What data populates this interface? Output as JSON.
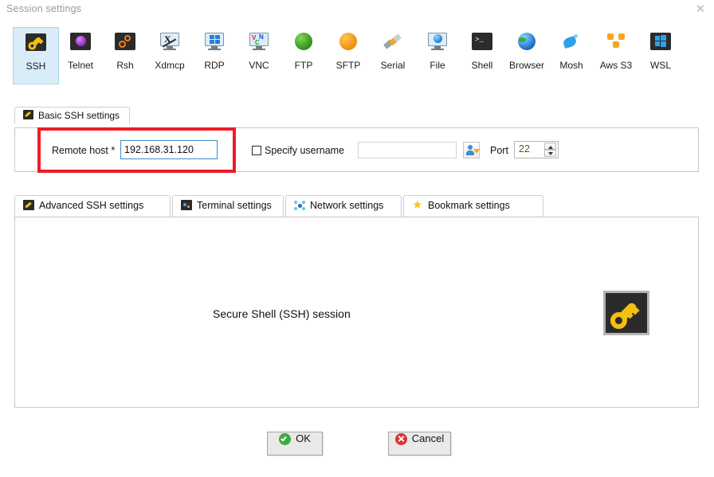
{
  "window": {
    "title": "Session settings",
    "close_label": "✕"
  },
  "session_types": [
    {
      "label": "SSH",
      "icon": "ssh-key-icon",
      "selected": true
    },
    {
      "label": "Telnet",
      "icon": "telnet-orb-icon",
      "selected": false
    },
    {
      "label": "Rsh",
      "icon": "rsh-gears-icon",
      "selected": false
    },
    {
      "label": "Xdmcp",
      "icon": "xdmcp-monitor-icon",
      "selected": false
    },
    {
      "label": "RDP",
      "icon": "rdp-monitor-icon",
      "selected": false
    },
    {
      "label": "VNC",
      "icon": "vnc-monitor-icon",
      "selected": false
    },
    {
      "label": "FTP",
      "icon": "ftp-green-globe-icon",
      "selected": false
    },
    {
      "label": "SFTP",
      "icon": "sftp-orange-globe-icon",
      "selected": false
    },
    {
      "label": "Serial",
      "icon": "serial-plug-icon",
      "selected": false
    },
    {
      "label": "File",
      "icon": "file-monitor-globe-icon",
      "selected": false
    },
    {
      "label": "Shell",
      "icon": "shell-terminal-icon",
      "selected": false
    },
    {
      "label": "Browser",
      "icon": "browser-globe-icon",
      "selected": false
    },
    {
      "label": "Mosh",
      "icon": "mosh-satellite-icon",
      "selected": false
    },
    {
      "label": "Aws S3",
      "icon": "aws-s3-icon",
      "selected": false
    },
    {
      "label": "WSL",
      "icon": "wsl-windows-icon",
      "selected": false
    }
  ],
  "basic_settings": {
    "tab_label": "Basic SSH settings",
    "remote_host_label": "Remote host *",
    "remote_host_value": "192.168.31.120",
    "specify_username_label": "Specify username",
    "specify_username_checked": false,
    "username_value": "",
    "port_label": "Port",
    "port_value": "22"
  },
  "lower_tabs": [
    {
      "label": "Advanced SSH settings",
      "icon": "ssh-key-icon"
    },
    {
      "label": "Terminal settings",
      "icon": "terminal-icon"
    },
    {
      "label": "Network settings",
      "icon": "network-atom-icon"
    },
    {
      "label": "Bookmark settings",
      "icon": "star-icon"
    }
  ],
  "content": {
    "description": "Secure Shell (SSH) session",
    "icon": "ssh-key-large-icon"
  },
  "buttons": {
    "ok_label": "OK",
    "cancel_label": "Cancel"
  },
  "colors": {
    "accent_blue": "#3f8ccb",
    "selection_bg": "#d9edf9",
    "annotation_red": "#ee1c25",
    "key_yellow": "#f2c012",
    "ok_green": "#3faa3f",
    "cancel_red": "#dd3333"
  }
}
